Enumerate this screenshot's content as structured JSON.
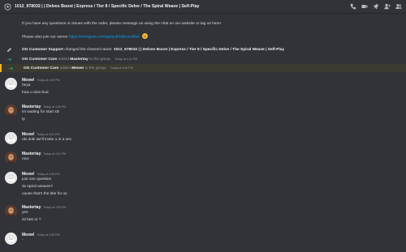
{
  "window": {
    "title": "1012_978032 | | Delves Boost | Express / Tier 8 / Specific Delve / The Spiral Weave | Self-Play"
  },
  "toolbar": {
    "icons": [
      "phone-icon",
      "video-icon",
      "pin-icon",
      "add-member-icon",
      "members-icon"
    ]
  },
  "intro": {
    "line1": "If you have any questions or issues with the order, please message us using the chat on our website or tag us here!",
    "line2_prefix": "Please also join our server",
    "line2_link": "https://overgear.com/api/auth/discord/bot"
  },
  "system_events": [
    {
      "actor": "OG Customer Support",
      "text_a": "changed the channel name:",
      "text_b": "1012_978032 | | Delves Boost | Express / Tier 8 / Specific Delve / The Spiral Weave | Self-Play",
      "time": ""
    },
    {
      "actor": "OG Customer Care",
      "verb": "added",
      "target": "Mastertay",
      "suffix": "to the group.",
      "time": "Today at 4:41 PM"
    },
    {
      "actor": "OG Customer Care",
      "verb": "added",
      "target": "Meow!",
      "suffix": "to the group.",
      "time": "Today at 4:50 PM"
    }
  ],
  "messages": [
    {
      "author": "Meow!",
      "time": "Today at 4:50 PM",
      "lines": [
        "heya",
        "how u doin bud"
      ]
    },
    {
      "author": "Mastertay",
      "time": "Today at 4:50 PM",
      "lines": [
        "im waiting  for start xD",
        "ty"
      ]
    },
    {
      "author": "Meow!",
      "time": "Today at 4:51 PM",
      "lines": [
        "oki doki we'll invite u in a sec"
      ]
    },
    {
      "author": "Mastertay",
      "time": "Today at 4:51 PM",
      "lines": [
        "nice"
      ]
    },
    {
      "author": "Meow!",
      "time": "Today at 4:54 PM",
      "lines": [
        "just one question",
        "3x spiral weaves?",
        "cause that's the title for us"
      ]
    },
    {
      "author": "Mastertay",
      "time": "Today at 4:55 PM",
      "lines": [
        "yes",
        "ist fast or ?"
      ]
    },
    {
      "author": "Meow!",
      "time": "Today at 4:55 PM",
      "lines": [
        "-"
      ]
    }
  ],
  "colors": {
    "background": "#313338",
    "link": "#00a8fc",
    "join_arrow": "#23a55a",
    "highlight_bar": "#f0b232"
  }
}
